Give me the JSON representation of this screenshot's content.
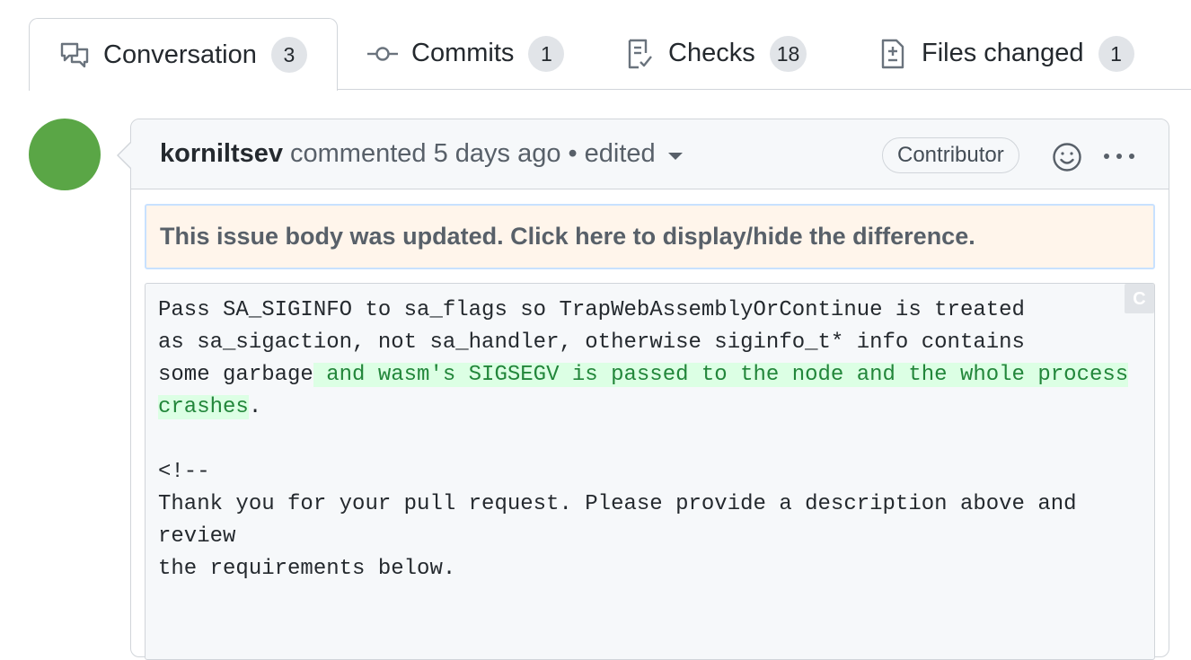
{
  "tabs": {
    "conversation": {
      "label": "Conversation",
      "count": "3",
      "icon": "comment-discussion-icon"
    },
    "commits": {
      "label": "Commits",
      "count": "1",
      "icon": "git-commit-icon"
    },
    "checks": {
      "label": "Checks",
      "count": "18",
      "icon": "checklist-icon"
    },
    "files": {
      "label": "Files changed",
      "count": "1",
      "icon": "file-diff-icon"
    }
  },
  "comment": {
    "author": "korniltsev",
    "action": "commented",
    "time": "5 days ago",
    "separator": "•",
    "edited": "edited",
    "badge": "Contributor",
    "avatar_color": "#5aa646",
    "notice": "This issue body was updated. Click here to display/hide the difference.",
    "copy_label": "C",
    "body": {
      "line1": "Pass SA_SIGINFO to sa_flags so TrapWebAssemblyOrContinue is treated",
      "line2": "as sa_sigaction, not sa_handler, otherwise siginfo_t* info contains",
      "line3_plain": "some garbage",
      "line3_added": " and wasm's SIGSEGV is passed to the node and the whole process",
      "line4_added": "crashes",
      "line4_plain": ".",
      "line5": "",
      "line6": "<!--",
      "line7": "Thank you for your pull request. Please provide a description above and",
      "line8": "review",
      "line9": "the requirements below."
    }
  },
  "colors": {
    "added_bg": "#dcffe4",
    "added_text": "#22863a",
    "notice_bg": "#fff5eb"
  }
}
